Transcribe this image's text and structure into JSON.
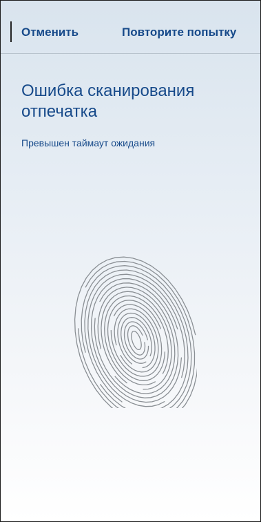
{
  "toolbar": {
    "cancel_label": "Отменить",
    "retry_label": "Повторите попытку"
  },
  "dialog": {
    "title": "Ошибка сканирования отпечатка",
    "message": "Превышен таймаут ожидания"
  },
  "colors": {
    "accent": "#174a8a",
    "background_top": "#d9e4ee",
    "background_bottom": "#ffffff",
    "fingerprint_stroke": "#8a8f94"
  },
  "icons": {
    "fingerprint": "fingerprint-icon"
  }
}
